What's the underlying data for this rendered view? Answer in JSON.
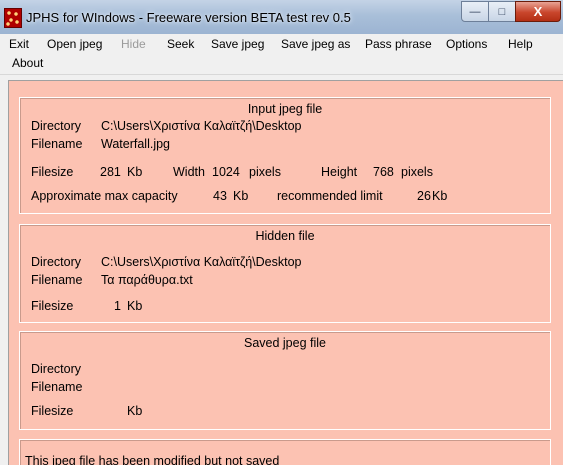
{
  "window": {
    "title": "JPHS for WIndows - Freeware version BETA test rev 0.5",
    "minimize_glyph": "—",
    "maximize_glyph": "□",
    "close_glyph": "X",
    "icon": "jphs-app-icon"
  },
  "menu": {
    "exit": "Exit",
    "open_jpeg": "Open jpeg",
    "hide": "Hide",
    "seek": "Seek",
    "save_jpeg": "Save jpeg",
    "save_jpeg_as": "Save jpeg as",
    "pass_phrase": "Pass phrase",
    "options": "Options",
    "help": "Help",
    "about": "About"
  },
  "input_file": {
    "title": "Input jpeg file",
    "directory_label": "Directory",
    "directory_value": "C:\\Users\\Χριστίνα Καλαϊτζή\\Desktop",
    "filename_label": "Filename",
    "filename_value": "Waterfall.jpg",
    "filesize_label": "Filesize",
    "filesize_value": "281",
    "filesize_unit": "Kb",
    "width_label": "Width",
    "width_value": "1024",
    "width_unit": "pixels",
    "height_label": "Height",
    "height_value": "768",
    "height_unit": "pixels",
    "capacity_label": "Approximate max capacity",
    "capacity_value": "43",
    "capacity_unit": "Kb",
    "limit_label": "recommended limit",
    "limit_value": "26",
    "limit_unit": "Kb"
  },
  "hidden_file": {
    "title": "Hidden file",
    "directory_label": "Directory",
    "directory_value": "C:\\Users\\Χριστίνα Καλαϊτζή\\Desktop",
    "filename_label": "Filename",
    "filename_value": "Τα παράθυρα.txt",
    "filesize_label": "Filesize",
    "filesize_value": "1",
    "filesize_unit": "Kb"
  },
  "saved_file": {
    "title": "Saved jpeg file",
    "directory_label": "Directory",
    "filename_label": "Filename",
    "filesize_label": "Filesize",
    "filesize_unit": "Kb"
  },
  "status": {
    "message": "This jpeg file has been modified but not saved"
  },
  "colors": {
    "client_background": "#fcc2b2",
    "title_bar": "#a9bfd9",
    "close_button": "#c9462c"
  }
}
